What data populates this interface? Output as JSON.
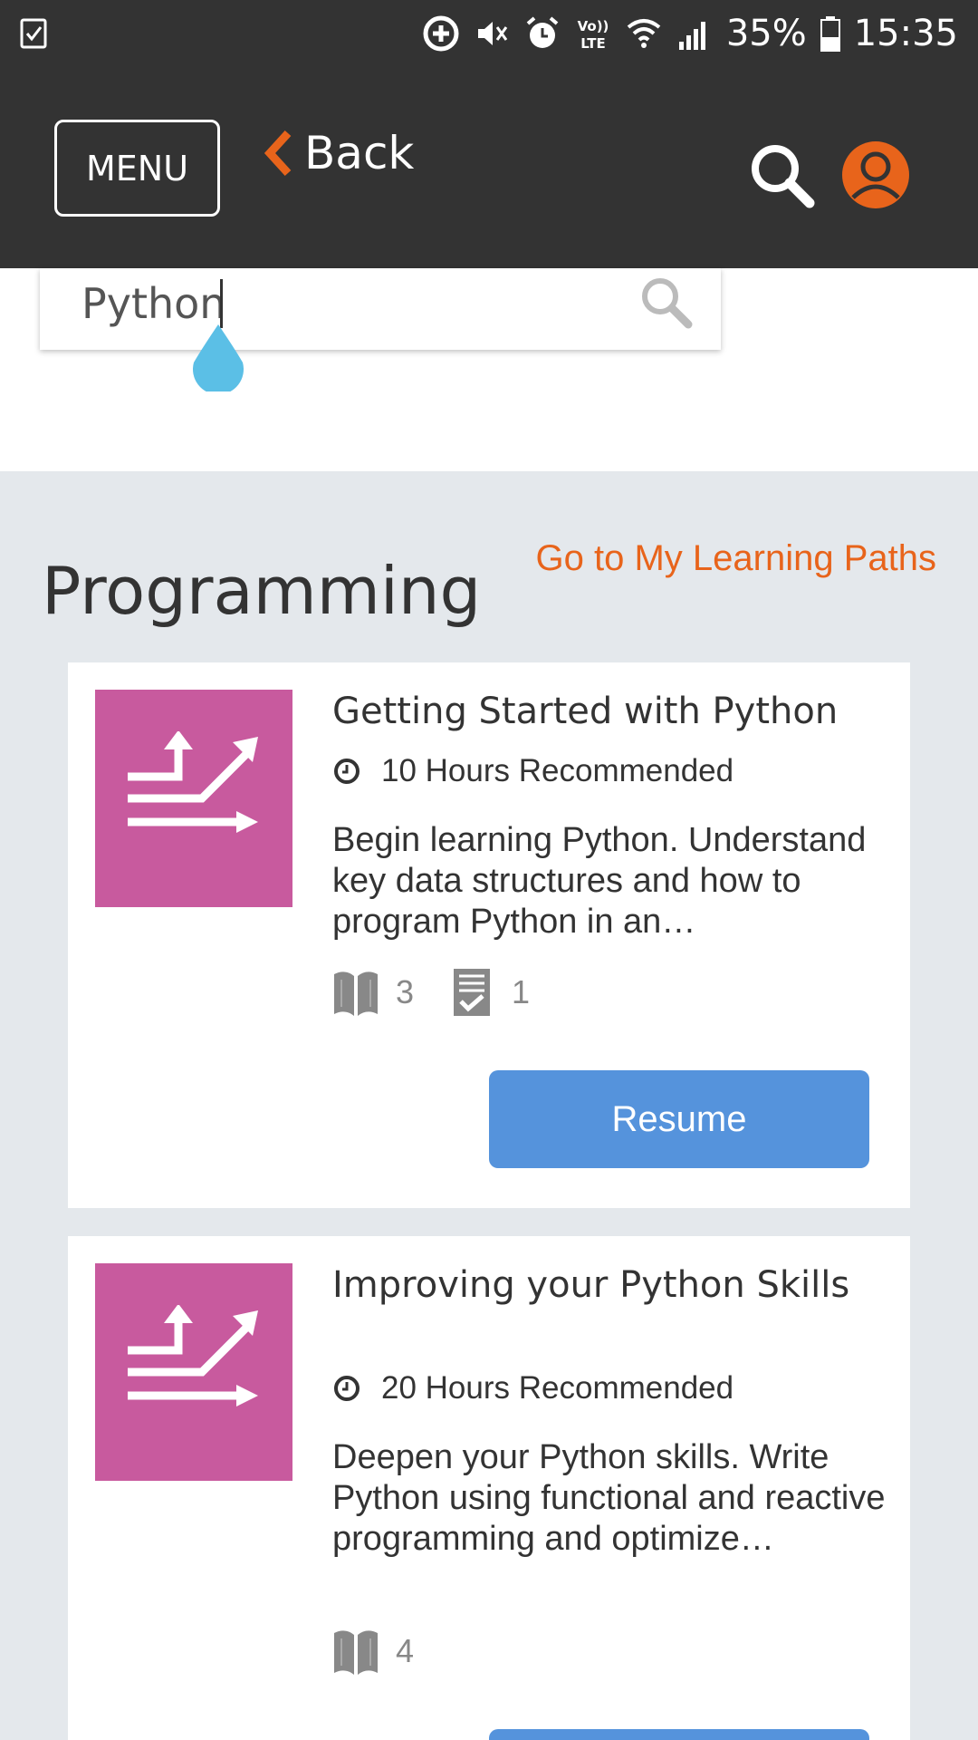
{
  "status_bar": {
    "left_icon": "task-check-icon",
    "icons": [
      "data-saver-icon",
      "mute-icon",
      "alarm-icon",
      "volte-icon",
      "wifi-icon",
      "signal-icon"
    ],
    "volte_label": "Vo)) LTE",
    "battery": "35%",
    "time": "15:35"
  },
  "header": {
    "menu_label": "MENU",
    "back_label": "Back",
    "accent_color": "#e8641b",
    "background": "#333333"
  },
  "search": {
    "value": "Python"
  },
  "section": {
    "title": "Programming",
    "link": "Go to My Learning Paths"
  },
  "cards": [
    {
      "title": "Getting Started with Python",
      "duration": "10 Hours Recommended",
      "description": "Begin learning Python. Understand key data structures and how to program Python in an…",
      "books_count": "3",
      "assessments_count": "1",
      "action_label": "Resume",
      "thumb_color": "#c85a9e"
    },
    {
      "title": "Improving your Python Skills",
      "duration": "20 Hours Recommended",
      "description": "Deepen your Python skills. Write Python using functional and reactive programming and optimize…",
      "books_count": "4",
      "thumb_color": "#c85a9e"
    }
  ]
}
